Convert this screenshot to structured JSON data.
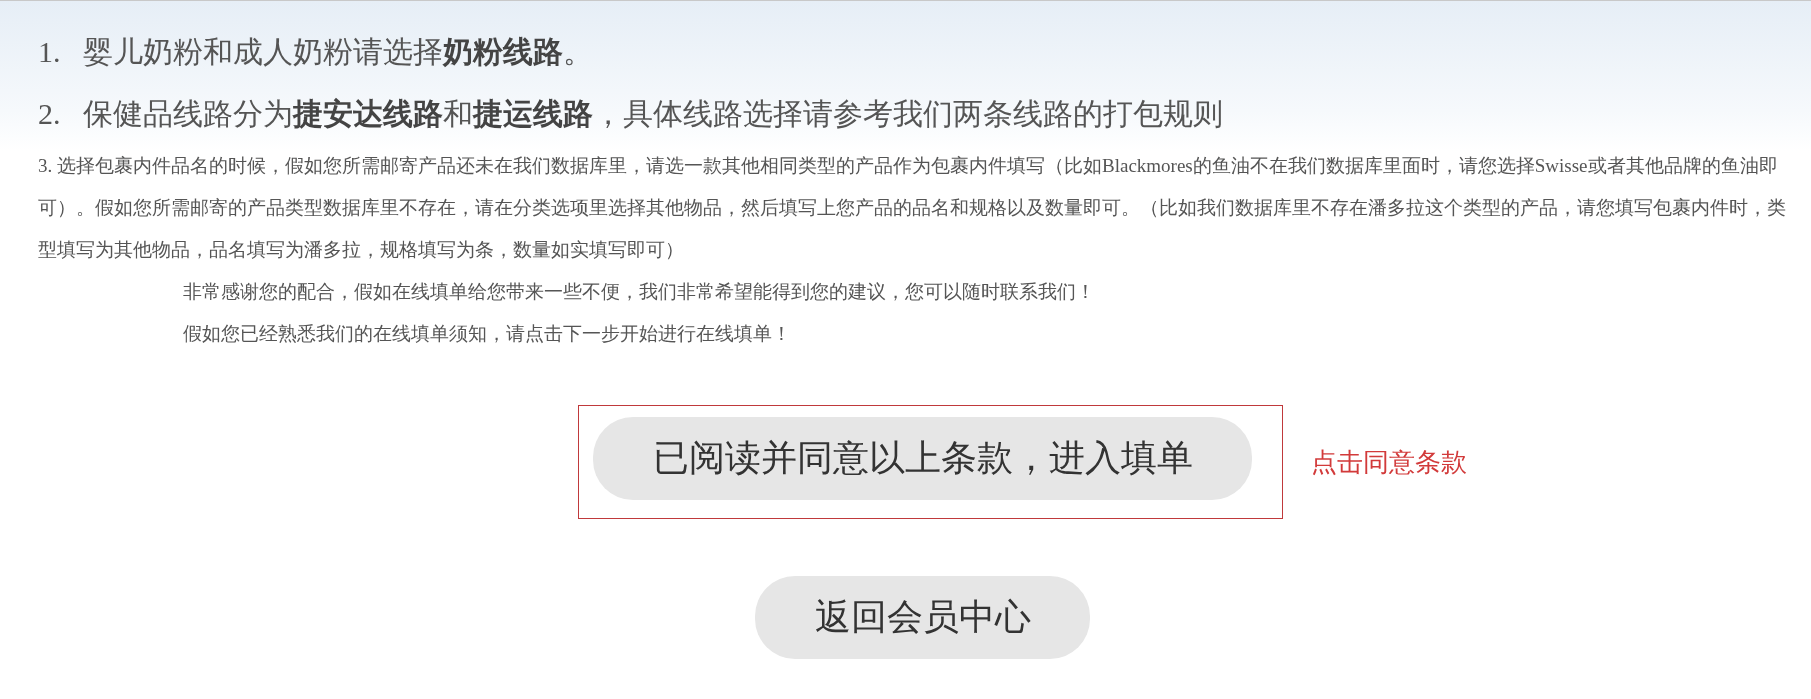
{
  "rules": [
    {
      "number": "1.",
      "text": "婴儿奶粉和成人奶粉请选择**奶粉线路**。"
    },
    {
      "number": "2.",
      "text": "保健品线路分为**捷安达线路**和**捷运线路**，具体线路选择请参考我们两条线路的打包规则"
    }
  ],
  "note": "3. 选择包裹内件品名的时候，假如您所需邮寄产品还未在我们数据库里，请选一款其他相同类型的产品作为包裹内件填写（比如Blackmores的鱼油不在我们数据库里面时，请您选择Swisse或者其他品牌的鱼油即可）。假如您所需邮寄的产品类型数据库里不存在，请在分类选项里选择其他物品，然后填写上您产品的品名和规格以及数量即可。（比如我们数据库里不存在潘多拉这个类型的产品，请您填写包裹内件时，类型填写为其他物品，品名填写为潘多拉，规格填写为条，数量如实填写即可）",
  "closing": [
    "非常感谢您的配合，假如在线填单给您带来一些不便，我们非常希望能得到您的建议，您可以随时联系我们！",
    "假如您已经熟悉我们的在线填单须知，请点击下一步开始进行在线填单！"
  ],
  "agree_button": "已阅读并同意以上条款，进入填单",
  "agree_hint": "点击同意条款",
  "back_button": "返回会员中心"
}
